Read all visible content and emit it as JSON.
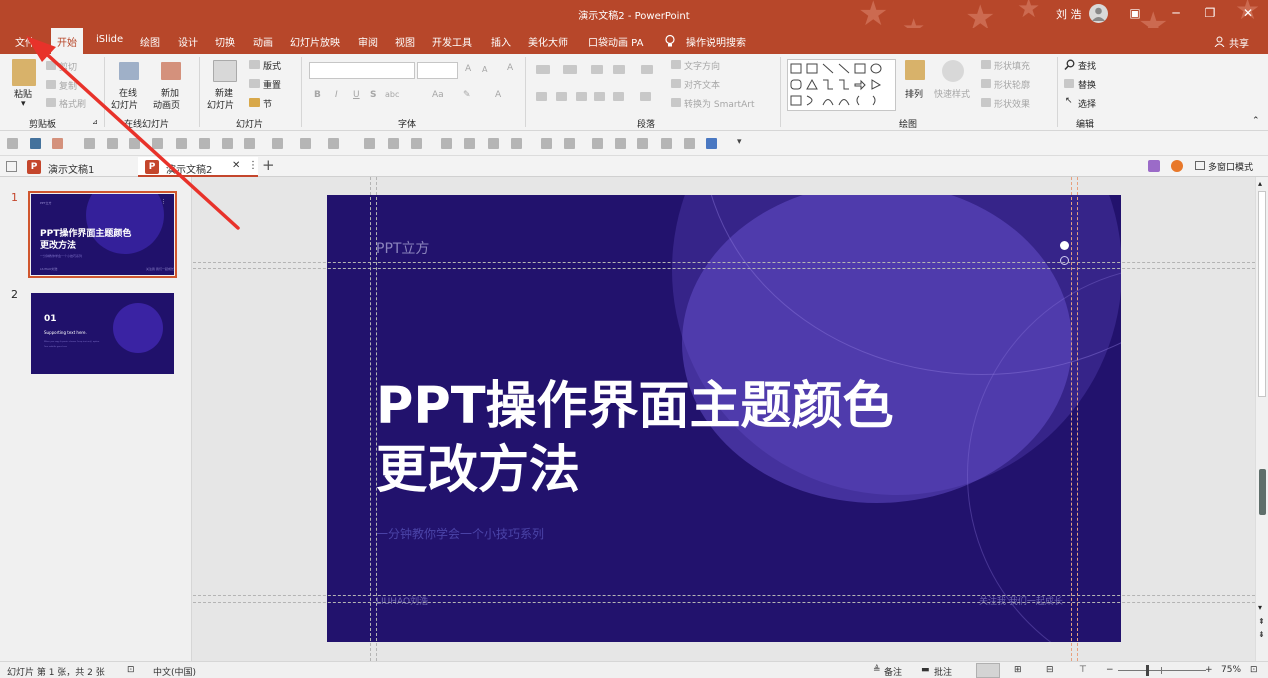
{
  "titlebar": {
    "title": "演示文稿2  -  PowerPoint",
    "user": "刘 浩",
    "minimize": "─",
    "restore": "❐",
    "close": "✕",
    "ribbon_display": "▣"
  },
  "tabs": [
    {
      "label": "文件"
    },
    {
      "label": "开始"
    },
    {
      "label": "iSlide"
    },
    {
      "label": "绘图"
    },
    {
      "label": "设计"
    },
    {
      "label": "切换"
    },
    {
      "label": "动画"
    },
    {
      "label": "幻灯片放映"
    },
    {
      "label": "审阅"
    },
    {
      "label": "视图"
    },
    {
      "label": "开发工具"
    },
    {
      "label": "插入"
    },
    {
      "label": "美化大师"
    },
    {
      "label": "口袋动画 PA"
    }
  ],
  "tellme": "操作说明搜索",
  "share": "共享",
  "ribbon": {
    "clipboard": {
      "paste": "粘贴",
      "cut": "剪切",
      "copy": "复制",
      "format_painter": "格式刷",
      "group": "剪贴板"
    },
    "online": {
      "online_slides": "在线",
      "online_slides2": "幻灯片",
      "new_anim": "新加",
      "new_anim2": "动画页",
      "group": "在线幻灯片"
    },
    "slides": {
      "new_slide": "新建",
      "new_slide2": "幻灯片",
      "layout": "版式",
      "reset": "重置",
      "section": "节",
      "group": "幻灯片"
    },
    "font": {
      "bold": "B",
      "italic": "I",
      "underline": "U",
      "strike": "S",
      "spacing": "abc",
      "case": "Aa",
      "group": "字体"
    },
    "paragraph": {
      "text_direction": "文字方向",
      "align_text": "对齐文本",
      "smartart": "转换为 SmartArt",
      "group": "段落"
    },
    "drawing": {
      "arrange": "排列",
      "quick_styles": "快速样式",
      "fill": "形状填充",
      "outline": "形状轮廓",
      "effects": "形状效果",
      "group": "绘图"
    },
    "editing": {
      "find": "查找",
      "replace": "替换",
      "select": "选择",
      "group": "编辑"
    }
  },
  "doctabs": [
    {
      "label": "演示文稿1"
    },
    {
      "label": "演示文稿2"
    }
  ],
  "multiwindow": "多窗口模式",
  "thumbs": [
    {
      "num": "1",
      "brand": "PPT立方",
      "title1": "PPT操作界面主题颜色",
      "title2": "更改方法",
      "sub": "一分钟教你学会一个小技巧系列",
      "left": "LIUHAO刘浩",
      "right": "关注我 我们一起成长"
    },
    {
      "num": "2",
      "big": "01",
      "sub": "Supporting text here.",
      "l1": "When you copy & paste, choose 'keep text only' option.",
      "l2": "Your subtitle goes here"
    }
  ],
  "slide": {
    "brand": "PPT立方",
    "title_line1": "PPT操作界面主题颜色",
    "title_line2": "更改方法",
    "subtitle": "一分钟教你学会一个小技巧系列",
    "footer_left": "LIUHAO刘浩",
    "footer_right": "关注我 我们一起成长"
  },
  "status": {
    "slide_info": "幻灯片 第 1 张，共 2 张",
    "language": "中文(中国)",
    "notes": "备注",
    "comments": "批注",
    "zoom": "75%",
    "minus": "−",
    "plus": "+"
  },
  "colors": {
    "accent": "#b7472a",
    "slide_bg": "#22126d",
    "annotation_arrow": "#e8322a"
  }
}
